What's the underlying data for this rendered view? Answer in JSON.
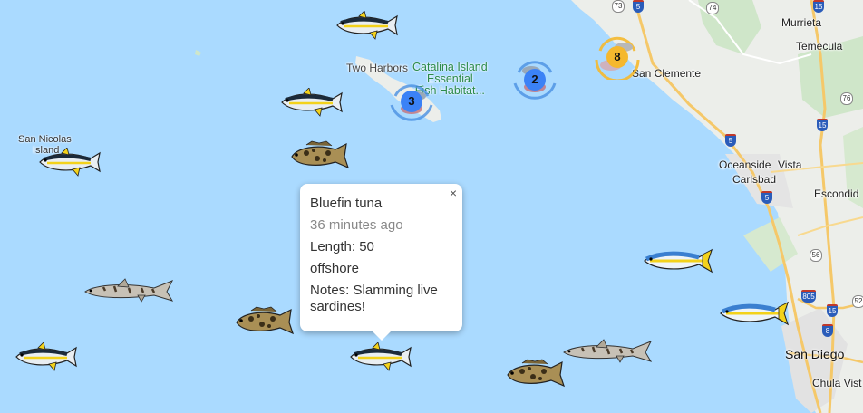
{
  "map": {
    "colors": {
      "water": "#aadaff",
      "land": "#e8eae6",
      "park": "#cfe6c9",
      "freeway": "#f5c869",
      "road": "#ffffff"
    },
    "labels": {
      "two_harbors": "Two Harbors",
      "catalina": [
        "Catalina Island",
        "Essential",
        "Fish Habitat..."
      ],
      "san_nicolas": [
        "San Nicolas",
        "Island"
      ],
      "murrieta": "Murrieta",
      "temecula": "Temecula",
      "san_clemente": "San Clemente",
      "oceanside": "Oceanside",
      "vista": "Vista",
      "carlsbad": "Carlsbad",
      "escondido": "Escondid",
      "san_diego": "San Diego",
      "chula_vista": "Chula Vist"
    },
    "shields": [
      "73",
      "5",
      "74",
      "15",
      "76",
      "5",
      "15",
      "5",
      "56",
      "805",
      "15",
      "8",
      "52"
    ]
  },
  "clusters": [
    {
      "count": "3",
      "color": "#3b82f6"
    },
    {
      "count": "2",
      "color": "#3b82f6"
    },
    {
      "count": "8",
      "color": "#f5b82e"
    }
  ],
  "fish_markers": [
    {
      "species": "yellowfin-tuna"
    },
    {
      "species": "yellowfin-tuna"
    },
    {
      "species": "yellowfin-tuna"
    },
    {
      "species": "calico-bass"
    },
    {
      "species": "yellowtail"
    },
    {
      "species": "leopard-shark"
    },
    {
      "species": "calico-bass"
    },
    {
      "species": "yellowtail"
    },
    {
      "species": "yellowfin-tuna"
    },
    {
      "species": "leopard-shark"
    },
    {
      "species": "yellowfin-tuna"
    },
    {
      "species": "calico-bass"
    }
  ],
  "popup": {
    "title": "Bluefin tuna",
    "time": "36 minutes ago",
    "length": "Length: 50",
    "location": "offshore",
    "notes": "Notes: Slamming live sardines!",
    "close": "×"
  }
}
